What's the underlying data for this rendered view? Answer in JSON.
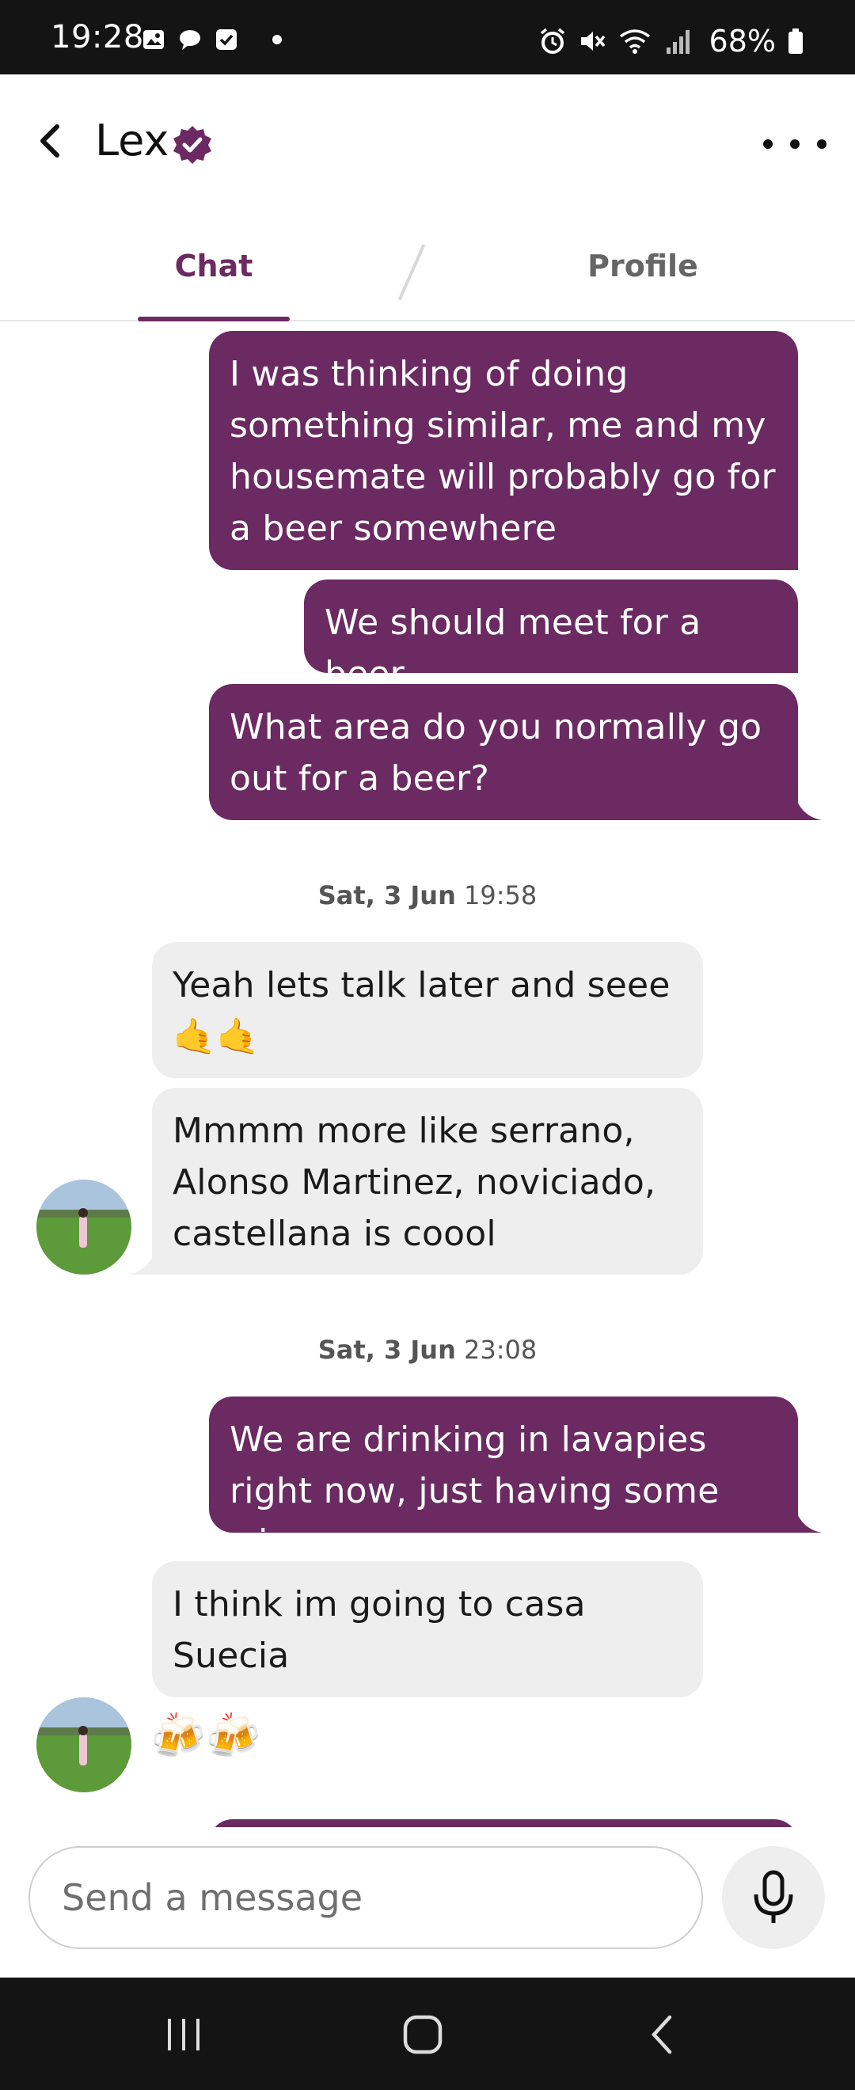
{
  "status_bar": {
    "time": "19:28",
    "battery": "68%",
    "icons_left": [
      "gallery-icon",
      "chat-icon",
      "checkbox-icon"
    ],
    "icons_right": [
      "alarm-icon",
      "mute-icon",
      "wifi-icon",
      "signal-icon",
      "battery-icon"
    ]
  },
  "header": {
    "contact_name": "Lex",
    "verified_icon": "verified-badge-icon",
    "accent": "#6b2a62"
  },
  "tabs": [
    {
      "label": "Chat",
      "active": true
    },
    {
      "label": "Profile",
      "active": false
    }
  ],
  "messages": [
    {
      "from": "me",
      "text": "I was thinking of doing something similar, me and my housemate will probably go for a beer somewhere"
    },
    {
      "from": "me",
      "text": "We should meet for a beer"
    },
    {
      "from": "me",
      "text": "What area do you normally go out for a beer?"
    },
    {
      "type": "date",
      "day": "Sat, 3 Jun",
      "time": "19:58"
    },
    {
      "from": "them",
      "text": "Yeah lets talk later and seee 🤙🤙"
    },
    {
      "from": "them",
      "text": "Mmmm more like serrano, Alonso Martinez, noviciado, castellana is coool"
    },
    {
      "type": "date",
      "day": "Sat, 3 Jun",
      "time": "23:08"
    },
    {
      "from": "me",
      "text": "We are drinking in lavapies right now, just having some wine"
    },
    {
      "from": "them",
      "text": "I think im going to casa Suecia"
    },
    {
      "from": "them",
      "text": "🍻🍻"
    }
  ],
  "composer": {
    "placeholder": "Send a message",
    "mic_icon": "microphone-icon"
  },
  "nav_bar": {
    "buttons": [
      "recent-apps-icon",
      "home-icon",
      "back-nav-icon"
    ]
  }
}
